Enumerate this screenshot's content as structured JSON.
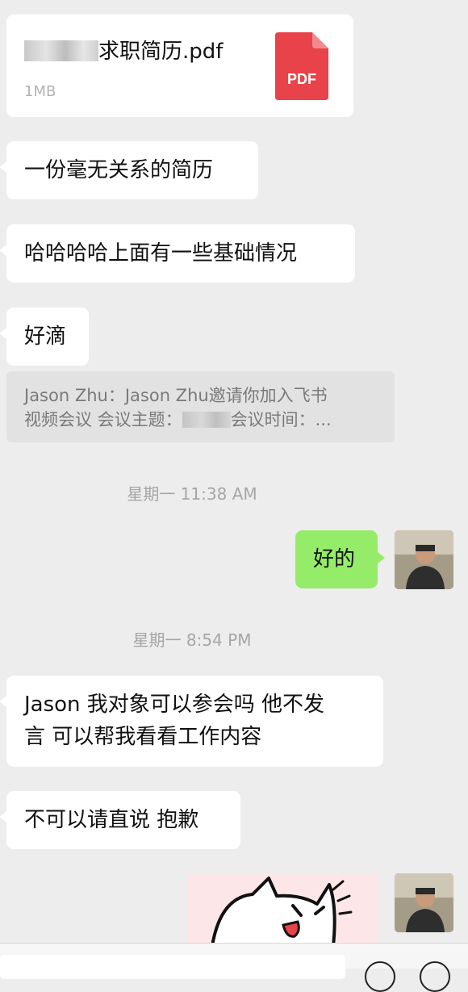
{
  "messages": {
    "file": {
      "name_suffix": "求职简历.pdf",
      "size": "1MB",
      "badge": "PDF"
    },
    "m1": "一份毫无关系的简历",
    "m2": "哈哈哈哈上面有一些基础情况",
    "m3": "好滴",
    "quote_line1": "Jason Zhu：Jason Zhu邀请你加入飞书",
    "quote_line2a": "视频会议 会议主题：",
    "quote_line2b": "会议时间：...",
    "time1": "星期一 11:38 AM",
    "sent1": "好的",
    "time2": "星期一 8:54 PM",
    "m4_line1": "Jason 我对象可以参会吗 他不发",
    "m4_line2": "言 可以帮我看看工作内容",
    "m5": "不可以请直说 抱歉"
  },
  "colors": {
    "background": "#ededed",
    "sent_bubble": "#95ec69",
    "pdf_red": "#e8434a"
  },
  "icons": {
    "file": "pdf-file-icon",
    "emoji": "emoji-icon",
    "plus": "add-icon"
  }
}
